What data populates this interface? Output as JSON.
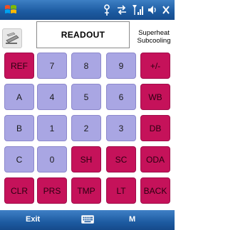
{
  "status_bar": {
    "icons": [
      "windows-flag-icon",
      "connectivity-icon",
      "sync-arrows-icon",
      "signal-icon",
      "volume-icon",
      "close-icon"
    ]
  },
  "header": {
    "app_icon": "stapler-icon",
    "readout": "READOUT",
    "mode_line1": "Superheat",
    "mode_line2": "Subcooling"
  },
  "colors": {
    "number_key": "#a9a6e3",
    "function_key": "#c5125a",
    "bar_blue": "#1c5aa0"
  },
  "keypad": {
    "rows": [
      [
        {
          "label": "REF",
          "type": "func"
        },
        {
          "label": "7",
          "type": "num"
        },
        {
          "label": "8",
          "type": "num"
        },
        {
          "label": "9",
          "type": "num"
        },
        {
          "label": "+/-",
          "type": "func"
        }
      ],
      [
        {
          "label": "A",
          "type": "num"
        },
        {
          "label": "4",
          "type": "num"
        },
        {
          "label": "5",
          "type": "num"
        },
        {
          "label": "6",
          "type": "num"
        },
        {
          "label": "WB",
          "type": "func"
        }
      ],
      [
        {
          "label": "B",
          "type": "num"
        },
        {
          "label": "1",
          "type": "num"
        },
        {
          "label": "2",
          "type": "num"
        },
        {
          "label": "3",
          "type": "num"
        },
        {
          "label": "DB",
          "type": "func"
        }
      ],
      [
        {
          "label": "C",
          "type": "num"
        },
        {
          "label": "0",
          "type": "num"
        },
        {
          "label": "SH",
          "type": "func"
        },
        {
          "label": "SC",
          "type": "func"
        },
        {
          "label": "ODA",
          "type": "func"
        }
      ],
      [
        {
          "label": "CLR",
          "type": "func"
        },
        {
          "label": "PRS",
          "type": "func"
        },
        {
          "label": "TMP",
          "type": "func"
        },
        {
          "label": "LT",
          "type": "func"
        },
        {
          "label": "BACK",
          "type": "func"
        }
      ]
    ]
  },
  "menu_bar": {
    "left_label": "Exit",
    "right_label": "M",
    "keyboard_icon": "keyboard-icon"
  }
}
